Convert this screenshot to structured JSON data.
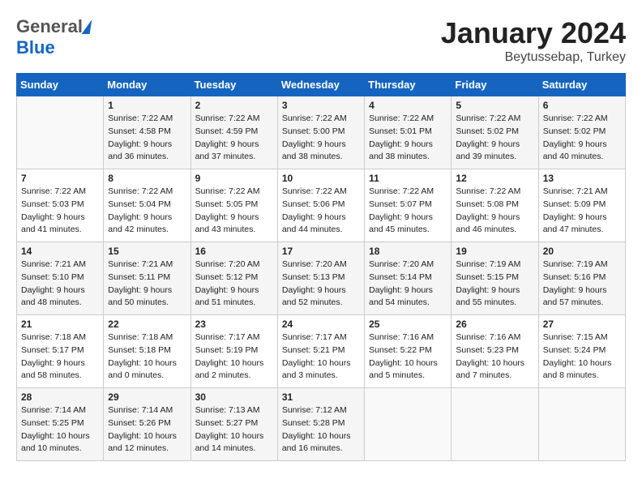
{
  "header": {
    "logo_general": "General",
    "logo_blue": "Blue",
    "month": "January 2024",
    "location": "Beytussebap, Turkey"
  },
  "days_of_week": [
    "Sunday",
    "Monday",
    "Tuesday",
    "Wednesday",
    "Thursday",
    "Friday",
    "Saturday"
  ],
  "weeks": [
    [
      {
        "day": "",
        "sunrise": "",
        "sunset": "",
        "daylight": ""
      },
      {
        "day": "1",
        "sunrise": "Sunrise: 7:22 AM",
        "sunset": "Sunset: 4:58 PM",
        "daylight": "Daylight: 9 hours and 36 minutes."
      },
      {
        "day": "2",
        "sunrise": "Sunrise: 7:22 AM",
        "sunset": "Sunset: 4:59 PM",
        "daylight": "Daylight: 9 hours and 37 minutes."
      },
      {
        "day": "3",
        "sunrise": "Sunrise: 7:22 AM",
        "sunset": "Sunset: 5:00 PM",
        "daylight": "Daylight: 9 hours and 38 minutes."
      },
      {
        "day": "4",
        "sunrise": "Sunrise: 7:22 AM",
        "sunset": "Sunset: 5:01 PM",
        "daylight": "Daylight: 9 hours and 38 minutes."
      },
      {
        "day": "5",
        "sunrise": "Sunrise: 7:22 AM",
        "sunset": "Sunset: 5:02 PM",
        "daylight": "Daylight: 9 hours and 39 minutes."
      },
      {
        "day": "6",
        "sunrise": "Sunrise: 7:22 AM",
        "sunset": "Sunset: 5:02 PM",
        "daylight": "Daylight: 9 hours and 40 minutes."
      }
    ],
    [
      {
        "day": "7",
        "sunrise": "Sunrise: 7:22 AM",
        "sunset": "Sunset: 5:03 PM",
        "daylight": "Daylight: 9 hours and 41 minutes."
      },
      {
        "day": "8",
        "sunrise": "Sunrise: 7:22 AM",
        "sunset": "Sunset: 5:04 PM",
        "daylight": "Daylight: 9 hours and 42 minutes."
      },
      {
        "day": "9",
        "sunrise": "Sunrise: 7:22 AM",
        "sunset": "Sunset: 5:05 PM",
        "daylight": "Daylight: 9 hours and 43 minutes."
      },
      {
        "day": "10",
        "sunrise": "Sunrise: 7:22 AM",
        "sunset": "Sunset: 5:06 PM",
        "daylight": "Daylight: 9 hours and 44 minutes."
      },
      {
        "day": "11",
        "sunrise": "Sunrise: 7:22 AM",
        "sunset": "Sunset: 5:07 PM",
        "daylight": "Daylight: 9 hours and 45 minutes."
      },
      {
        "day": "12",
        "sunrise": "Sunrise: 7:22 AM",
        "sunset": "Sunset: 5:08 PM",
        "daylight": "Daylight: 9 hours and 46 minutes."
      },
      {
        "day": "13",
        "sunrise": "Sunrise: 7:21 AM",
        "sunset": "Sunset: 5:09 PM",
        "daylight": "Daylight: 9 hours and 47 minutes."
      }
    ],
    [
      {
        "day": "14",
        "sunrise": "Sunrise: 7:21 AM",
        "sunset": "Sunset: 5:10 PM",
        "daylight": "Daylight: 9 hours and 48 minutes."
      },
      {
        "day": "15",
        "sunrise": "Sunrise: 7:21 AM",
        "sunset": "Sunset: 5:11 PM",
        "daylight": "Daylight: 9 hours and 50 minutes."
      },
      {
        "day": "16",
        "sunrise": "Sunrise: 7:20 AM",
        "sunset": "Sunset: 5:12 PM",
        "daylight": "Daylight: 9 hours and 51 minutes."
      },
      {
        "day": "17",
        "sunrise": "Sunrise: 7:20 AM",
        "sunset": "Sunset: 5:13 PM",
        "daylight": "Daylight: 9 hours and 52 minutes."
      },
      {
        "day": "18",
        "sunrise": "Sunrise: 7:20 AM",
        "sunset": "Sunset: 5:14 PM",
        "daylight": "Daylight: 9 hours and 54 minutes."
      },
      {
        "day": "19",
        "sunrise": "Sunrise: 7:19 AM",
        "sunset": "Sunset: 5:15 PM",
        "daylight": "Daylight: 9 hours and 55 minutes."
      },
      {
        "day": "20",
        "sunrise": "Sunrise: 7:19 AM",
        "sunset": "Sunset: 5:16 PM",
        "daylight": "Daylight: 9 hours and 57 minutes."
      }
    ],
    [
      {
        "day": "21",
        "sunrise": "Sunrise: 7:18 AM",
        "sunset": "Sunset: 5:17 PM",
        "daylight": "Daylight: 9 hours and 58 minutes."
      },
      {
        "day": "22",
        "sunrise": "Sunrise: 7:18 AM",
        "sunset": "Sunset: 5:18 PM",
        "daylight": "Daylight: 10 hours and 0 minutes."
      },
      {
        "day": "23",
        "sunrise": "Sunrise: 7:17 AM",
        "sunset": "Sunset: 5:19 PM",
        "daylight": "Daylight: 10 hours and 2 minutes."
      },
      {
        "day": "24",
        "sunrise": "Sunrise: 7:17 AM",
        "sunset": "Sunset: 5:21 PM",
        "daylight": "Daylight: 10 hours and 3 minutes."
      },
      {
        "day": "25",
        "sunrise": "Sunrise: 7:16 AM",
        "sunset": "Sunset: 5:22 PM",
        "daylight": "Daylight: 10 hours and 5 minutes."
      },
      {
        "day": "26",
        "sunrise": "Sunrise: 7:16 AM",
        "sunset": "Sunset: 5:23 PM",
        "daylight": "Daylight: 10 hours and 7 minutes."
      },
      {
        "day": "27",
        "sunrise": "Sunrise: 7:15 AM",
        "sunset": "Sunset: 5:24 PM",
        "daylight": "Daylight: 10 hours and 8 minutes."
      }
    ],
    [
      {
        "day": "28",
        "sunrise": "Sunrise: 7:14 AM",
        "sunset": "Sunset: 5:25 PM",
        "daylight": "Daylight: 10 hours and 10 minutes."
      },
      {
        "day": "29",
        "sunrise": "Sunrise: 7:14 AM",
        "sunset": "Sunset: 5:26 PM",
        "daylight": "Daylight: 10 hours and 12 minutes."
      },
      {
        "day": "30",
        "sunrise": "Sunrise: 7:13 AM",
        "sunset": "Sunset: 5:27 PM",
        "daylight": "Daylight: 10 hours and 14 minutes."
      },
      {
        "day": "31",
        "sunrise": "Sunrise: 7:12 AM",
        "sunset": "Sunset: 5:28 PM",
        "daylight": "Daylight: 10 hours and 16 minutes."
      },
      {
        "day": "",
        "sunrise": "",
        "sunset": "",
        "daylight": ""
      },
      {
        "day": "",
        "sunrise": "",
        "sunset": "",
        "daylight": ""
      },
      {
        "day": "",
        "sunrise": "",
        "sunset": "",
        "daylight": ""
      }
    ]
  ]
}
